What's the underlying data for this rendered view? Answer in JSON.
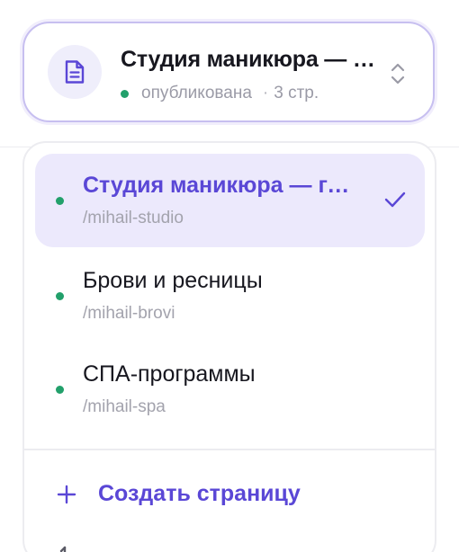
{
  "selector": {
    "title": "Студия маникюра — главная",
    "status": "опубликована",
    "separator": "·",
    "pages_count": "3 стр.",
    "icon": "document-icon",
    "chevron_icon": "chevron-up-down-icon",
    "status_color": "#22a06b"
  },
  "pages": [
    {
      "name": "Студия маникюра — главная",
      "slug": "/mihail-studio",
      "selected": true,
      "status_color": "#22a06b"
    },
    {
      "name": "Брови и ресницы",
      "slug": "/mihail-brovi",
      "selected": false,
      "status_color": "#22a06b"
    },
    {
      "name": "СПА-программы",
      "slug": "/mihail-spa",
      "selected": false,
      "status_color": "#22a06b"
    }
  ],
  "actions": {
    "create_label": "Создать страницу",
    "create_icon": "plus-icon"
  },
  "colors": {
    "accent": "#5a47d6",
    "selected_bg": "#ece9fc",
    "border_accent": "#c7bff0"
  }
}
